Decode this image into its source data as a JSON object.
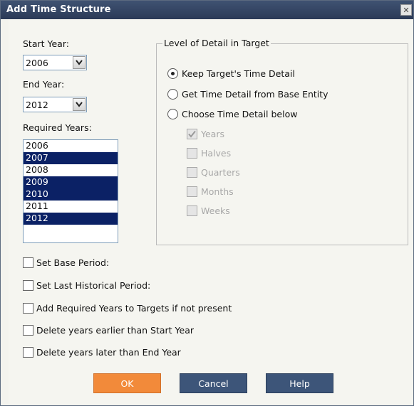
{
  "window": {
    "title": "Add Time Structure"
  },
  "start_year": {
    "label": "Start Year:",
    "value": "2006"
  },
  "end_year": {
    "label": "End Year:",
    "value": "2012"
  },
  "required_years": {
    "label": "Required Years:",
    "items": [
      {
        "year": "2006",
        "selected": false
      },
      {
        "year": "2007",
        "selected": true
      },
      {
        "year": "2008",
        "selected": false
      },
      {
        "year": "2009",
        "selected": true
      },
      {
        "year": "2010",
        "selected": true
      },
      {
        "year": "2011",
        "selected": false
      },
      {
        "year": "2012",
        "selected": true
      }
    ]
  },
  "detail_group": {
    "title": "Level of Detail in Target",
    "options": [
      {
        "label": "Keep Target's Time Detail",
        "checked": true
      },
      {
        "label": "Get Time Detail from Base Entity",
        "checked": false
      },
      {
        "label": "Choose Time Detail below",
        "checked": false
      }
    ],
    "sub_options": [
      {
        "label": "Years",
        "checked": true
      },
      {
        "label": "Halves",
        "checked": false
      },
      {
        "label": "Quarters",
        "checked": false
      },
      {
        "label": "Months",
        "checked": false
      },
      {
        "label": "Weeks",
        "checked": false
      }
    ]
  },
  "checkboxes": [
    {
      "label": "Set Base Period:"
    },
    {
      "label": "Set Last Historical Period:"
    },
    {
      "label": "Add Required Years to Targets if not present"
    },
    {
      "label": "Delete years earlier than Start Year"
    },
    {
      "label": "Delete years later than End Year"
    }
  ],
  "buttons": {
    "ok": "OK",
    "cancel": "Cancel",
    "help": "Help"
  },
  "colors": {
    "title_bar": "#2f3f5e",
    "selection": "#0b2165",
    "ok_button": "#f28a3a",
    "button": "#3d5579"
  }
}
